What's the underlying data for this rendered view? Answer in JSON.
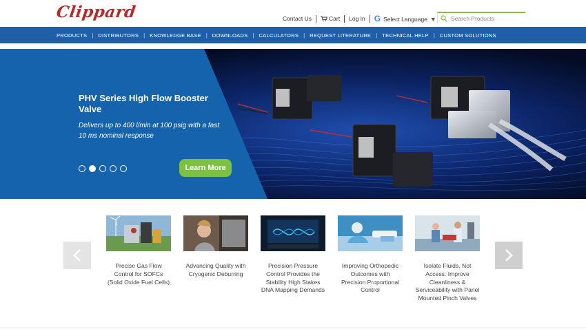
{
  "brand": {
    "logo_text": "Clippard",
    "logo_color": "#b22c2c"
  },
  "toplinks": {
    "contact": "Contact Us",
    "cart": "Cart",
    "login": "Log In",
    "language": "Select Language"
  },
  "search": {
    "placeholder": "Search Products"
  },
  "nav": {
    "items": [
      "PRODUCTS",
      "DISTRIBUTORS",
      "KNOWLEDGE BASE",
      "DOWNLOADS",
      "CALCULATORS",
      "REQUEST LITERATURE",
      "TECHNICAL HELP",
      "CUSTOM SOLUTIONS"
    ]
  },
  "hero": {
    "title": "PHV Series High Flow Booster Valve",
    "subtitle": "Delivers up to 400 l/min at 100 psig with a fast 10 ms nominal response",
    "button": "Learn More",
    "slide_count": 5,
    "active_slide": 2
  },
  "carousel": {
    "cards": [
      {
        "caption": "Precise Gas Flow Control for SOFCs (Solid Oxide Fuel Cells)"
      },
      {
        "caption": "Advancing Quality with Cryogenic Deburring"
      },
      {
        "caption": "Precision Pressure Control Provides the Stability High Stakes DNA Mapping Demands"
      },
      {
        "caption": "Improving Orthopedic Outcomes with Precision Proportional Control"
      },
      {
        "caption": "Isolate Fluids, Not Access: Improve Cleanliness & Serviceability with Panel Mounted Pinch Valves"
      }
    ]
  },
  "colors": {
    "nav_blue": "#1e5fa7",
    "hero_blue": "#1563ad",
    "accent_green": "#7cc142"
  },
  "icons": [
    "cart-icon",
    "google-icon",
    "dropdown-arrow-icon",
    "search-icon",
    "chevron-left-icon",
    "chevron-right-icon"
  ]
}
